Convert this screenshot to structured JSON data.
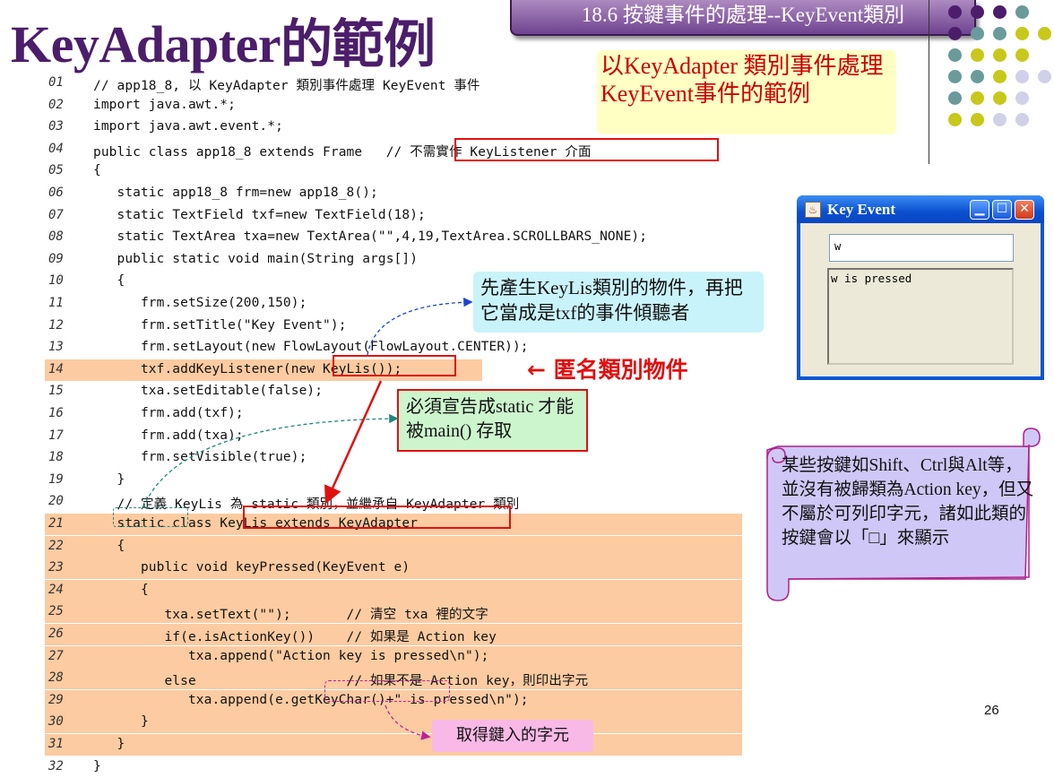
{
  "slide": {
    "title": "KeyAdapter的範例",
    "section_tab": "18.6 按鍵事件的處理--KeyEvent類別",
    "page_number": "26"
  },
  "callouts": {
    "yellow": "以KeyAdapter 類別事件處理KeyEvent事件的範例",
    "cyan": "先產生KeyLis類別的物件，再把它當成是txf的事件傾聽者",
    "anonymous": "← 匿名類別物件",
    "green": "必須宣告成static 才能被main() 存取",
    "pink": "取得鍵入的字元",
    "scroll": "某些按鍵如Shift、Ctrl與Alt等，並沒有被歸類為Action key，但又不屬於可列印字元，諸如此類的按鍵會以「□」來顯示"
  },
  "code_lines": [
    {
      "n": "01",
      "text": "// app18_8, 以 KeyAdapter 類別事件處理 KeyEvent 事件"
    },
    {
      "n": "02",
      "text": "import java.awt.*;"
    },
    {
      "n": "03",
      "text": "import java.awt.event.*;"
    },
    {
      "n": "04",
      "text": "public class app18_8 extends Frame   // 不需實作 KeyListener 介面"
    },
    {
      "n": "05",
      "text": "{"
    },
    {
      "n": "06",
      "text": "   static app18_8 frm=new app18_8();"
    },
    {
      "n": "07",
      "text": "   static TextField txf=new TextField(18);"
    },
    {
      "n": "08",
      "text": "   static TextArea txa=new TextArea(\"\",4,19,TextArea.SCROLLBARS_NONE);"
    },
    {
      "n": "09",
      "text": "   public static void main(String args[])"
    },
    {
      "n": "10",
      "text": "   {"
    },
    {
      "n": "11",
      "text": "      frm.setSize(200,150);"
    },
    {
      "n": "12",
      "text": "      frm.setTitle(\"Key Event\");"
    },
    {
      "n": "13",
      "text": "      frm.setLayout(new FlowLayout(FlowLayout.CENTER));"
    },
    {
      "n": "14",
      "text": "      txf.addKeyListener(new KeyLis());"
    },
    {
      "n": "15",
      "text": "      txa.setEditable(false);"
    },
    {
      "n": "16",
      "text": "      frm.add(txf);"
    },
    {
      "n": "17",
      "text": "      frm.add(txa);"
    },
    {
      "n": "18",
      "text": "      frm.setVisible(true);"
    },
    {
      "n": "19",
      "text": "   }"
    },
    {
      "n": "20",
      "text": "   // 定義 KeyLis 為 static 類別，並繼承自 KeyAdapter 類別"
    },
    {
      "n": "21",
      "text": "   static class KeyLis extends KeyAdapter"
    },
    {
      "n": "22",
      "text": "   {"
    },
    {
      "n": "23",
      "text": "      public void keyPressed(KeyEvent e)"
    },
    {
      "n": "24",
      "text": "      {"
    },
    {
      "n": "25",
      "text": "         txa.setText(\"\");       // 清空 txa 裡的文字"
    },
    {
      "n": "26",
      "text": "         if(e.isActionKey())    // 如果是 Action key"
    },
    {
      "n": "27",
      "text": "            txa.append(\"Action key is pressed\\n\");"
    },
    {
      "n": "28",
      "text": "         else                   // 如果不是 Action key，則印出字元"
    },
    {
      "n": "29",
      "text": "            txa.append(e.getKeyChar()+\" is pressed\\n\");"
    },
    {
      "n": "30",
      "text": "      }"
    },
    {
      "n": "31",
      "text": "   }"
    },
    {
      "n": "32",
      "text": "}"
    }
  ],
  "window": {
    "title": "Key Event",
    "textfield_value": "w",
    "textarea_value": "w is pressed",
    "icon": "java-cup-icon",
    "buttons": [
      "minimize-icon",
      "maximize-icon",
      "close-icon"
    ]
  },
  "colors": {
    "title": "#4b1d6b",
    "highlight": "#fccba1",
    "red": "#e01010",
    "dots": [
      "#4b1d6b",
      "#6b9a9a",
      "#c8c81a",
      "#d0d0e8"
    ]
  }
}
